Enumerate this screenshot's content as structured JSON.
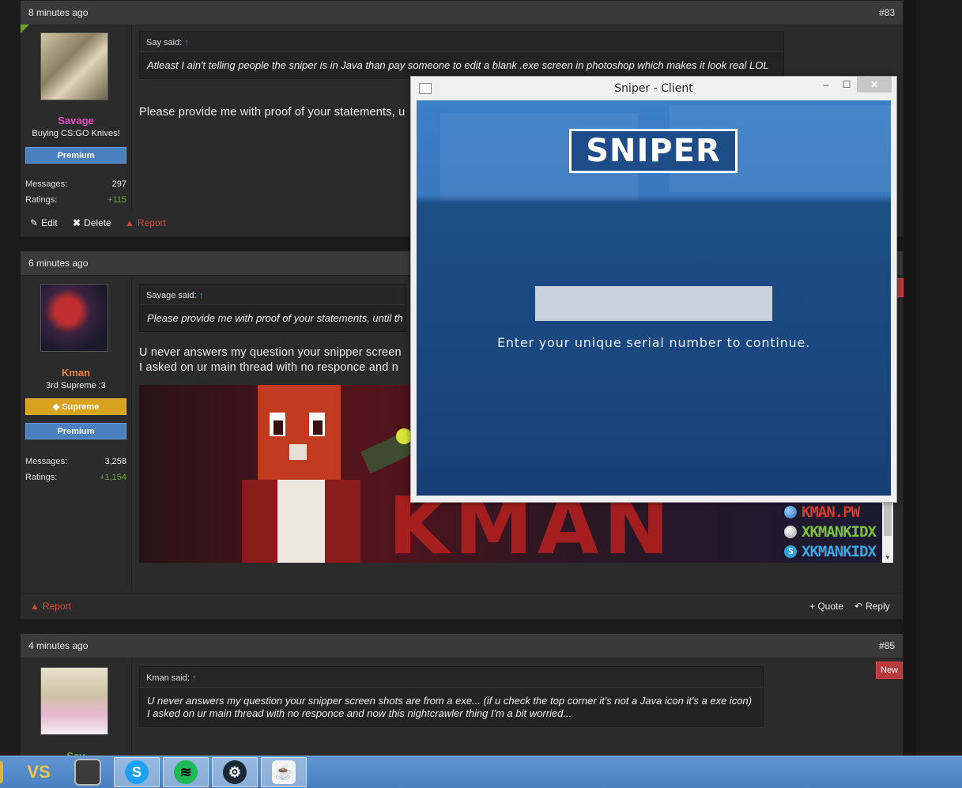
{
  "posts": [
    {
      "time": "8 minutes ago",
      "number": "#83",
      "user": {
        "name": "Savage",
        "name_color": "#e04fc5",
        "title": "Buying CS:GO Knives!",
        "badges": [
          "Premium"
        ],
        "messages_label": "Messages:",
        "messages": "297",
        "ratings_label": "Ratings:",
        "ratings": "+115"
      },
      "quote_author": "Say said:",
      "quote_arrow": "↑",
      "quote_text": "Atleast I ain't telling people the sniper is in Java than pay someone to edit a blank .exe screen in photoshop which makes it look real LOL",
      "message": "Please provide me with proof of your statements, u",
      "actions": {
        "edit": "Edit",
        "delete": "Delete",
        "report": "Report"
      }
    },
    {
      "time": "6 minutes ago",
      "user": {
        "name": "Kman",
        "name_color": "#e8893a",
        "title": "3rd Supreme :3",
        "badges": [
          "Supreme",
          "Premium"
        ],
        "messages_label": "Messages:",
        "messages": "3,258",
        "ratings_label": "Ratings:",
        "ratings": "+1,154"
      },
      "quote_author": "Savage said:",
      "quote_arrow": "↑",
      "quote_text": "Please provide me with proof of your statements, until th",
      "message_lines": [
        "U never answers my question your snipper screen",
        "I asked on ur main thread with no responce and n"
      ],
      "signature": {
        "big_text": "KMAN",
        "links": [
          {
            "text": "KMAN.PW",
            "color": "#d53a2b",
            "icon": "globe-icon"
          },
          {
            "text": "XKMANKIDX",
            "color": "#7dc23a",
            "icon": "xbox-icon"
          },
          {
            "text": "XKMANKIDX",
            "color": "#3aa7e0",
            "icon": "skype-icon"
          }
        ]
      },
      "actions": {
        "report": "Report",
        "quote": "+ Quote",
        "reply": "Reply"
      }
    },
    {
      "time": "4 minutes ago",
      "number": "#85",
      "new_label": "New",
      "user": {
        "name": "Say",
        "name_color": "#6ea832"
      },
      "quote_author": "Kman said:",
      "quote_arrow": "↑",
      "quote_lines": [
        "U never answers my question your snipper screen shots are from a exe... (if u check the top corner it's not a Java icon it's a exe icon)",
        "I asked on ur main thread with no responce and now this nightcrawler thing I'm a bit worried..."
      ]
    }
  ],
  "popup": {
    "title": "Sniper - Client",
    "min": "–",
    "max": "☐",
    "close": "✕",
    "logo": "SNIPER",
    "serial_value": "",
    "hint": "Enter your unique serial number to continue."
  },
  "taskbar": {
    "apps": [
      "folder-icon",
      "visual-studio-icon",
      "movie-maker-icon",
      "skype-icon",
      "spotify-icon",
      "steam-icon",
      "java-icon"
    ],
    "colors": {
      "skype": "#1da1f2",
      "spotify": "#1db954",
      "steam": "#1b2838"
    }
  },
  "colors": {
    "premium": "#4a7fc0",
    "supreme": "#d9a31f",
    "report": "#d94a3a"
  }
}
